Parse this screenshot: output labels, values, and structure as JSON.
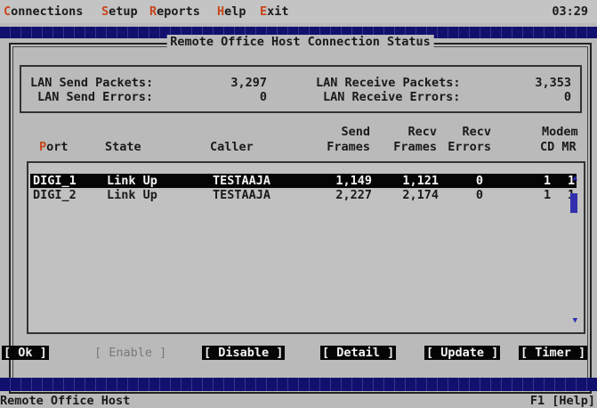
{
  "menu": {
    "items": [
      {
        "hot": "C",
        "rest": "onnections"
      },
      {
        "hot": "S",
        "rest": "etup"
      },
      {
        "hot": "R",
        "rest": "eports"
      },
      {
        "hot": "H",
        "rest": "elp"
      },
      {
        "hot": "E",
        "rest": "xit"
      }
    ],
    "clock": "03:29"
  },
  "window": {
    "title": "Remote Office Host Connection Status"
  },
  "stats": {
    "lan_send_packets_label": "LAN Send Packets:",
    "lan_send_packets_value": "3,297",
    "lan_send_errors_label": "LAN Send Errors:",
    "lan_send_errors_value": "0",
    "lan_receive_packets_label": "LAN Receive Packets:",
    "lan_receive_packets_value": "3,353",
    "lan_receive_errors_label": "LAN Receive Errors:",
    "lan_receive_errors_value": "0"
  },
  "columns": {
    "port_hot": "P",
    "port_rest": "ort",
    "state": "State",
    "caller": "Caller",
    "send_top": "Send",
    "send_bottom": "Frames",
    "recv_top": "Recv",
    "recv_bottom": "Frames",
    "recv_err_top": "Recv",
    "recv_err_bottom": "Errors",
    "modem_top": "Modem",
    "modem_bottom": "CD MR"
  },
  "rows": [
    {
      "port": "DIGI_1",
      "state": "Link Up",
      "caller": "TESTAAJA",
      "send": "1,149",
      "recv": "1,121",
      "errors": "0",
      "cd": "1",
      "mr": "1"
    },
    {
      "port": "DIGI_2",
      "state": "Link Up",
      "caller": "TESTAAJA",
      "send": "2,227",
      "recv": "2,174",
      "errors": "0",
      "cd": "1",
      "mr": "1"
    }
  ],
  "buttons": {
    "ok": "[ Ok ]",
    "enable": "[ Enable ]",
    "disable": "[ Disable ]",
    "detail": "[ Detail ]",
    "update": "[ Update ]",
    "timer": "[ Timer ]"
  },
  "statusbar": {
    "left": "Remote Office Host",
    "right": "F1 [Help]"
  },
  "icons": {
    "scroll_up": "up-arrow-icon",
    "scroll_down": "down-arrow-icon"
  },
  "colors": {
    "menu_hotkey": "#c8441c",
    "stripe": "#12106e",
    "scroll_thumb": "#3330b0"
  }
}
